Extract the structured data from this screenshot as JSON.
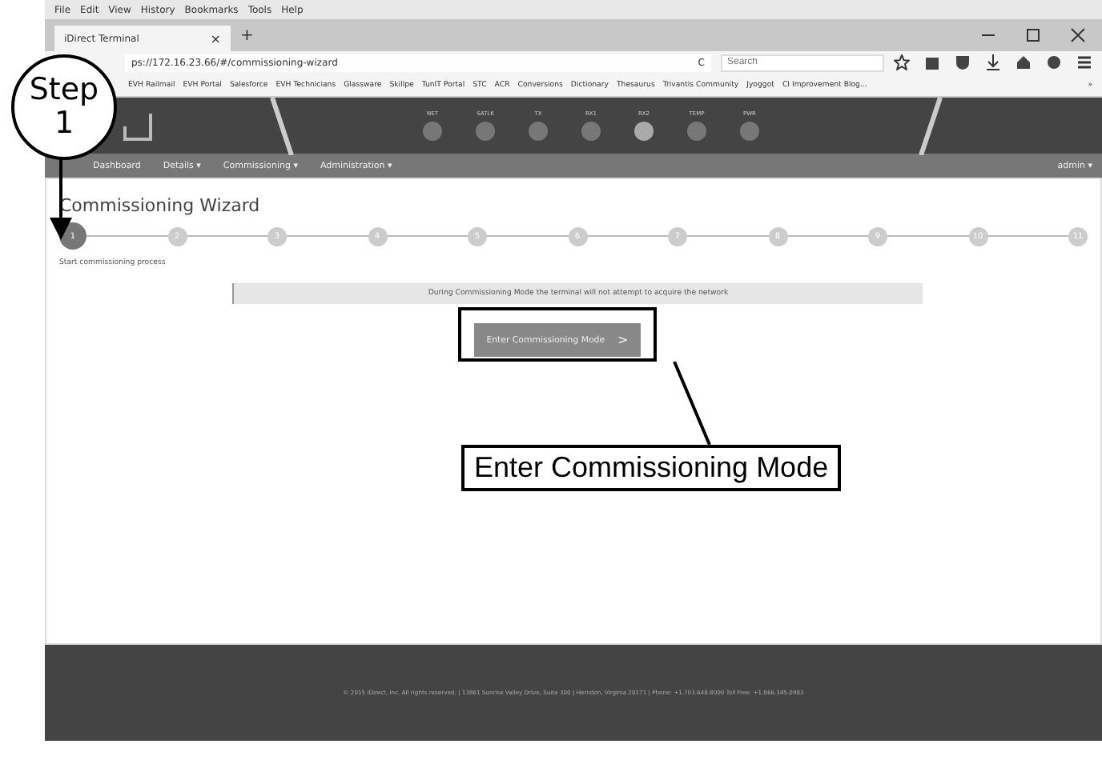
{
  "browser": {
    "menu": [
      "File",
      "Edit",
      "View",
      "History",
      "Bookmarks",
      "Tools",
      "Help"
    ],
    "tab": {
      "title": "iDirect Terminal",
      "close": "×"
    },
    "new_tab": "+",
    "url": "ps://172.16.23.66/#/commissioning-wizard",
    "reload": "C",
    "search": {
      "placeholder": "Search"
    },
    "bookmarks": [
      "EVH Railmail",
      "EVH Portal",
      "Salesforce",
      "EVH Technicians",
      "Glassware",
      "Skillpe",
      "TunIT Portal",
      "STC",
      "ACR",
      "Conversions",
      "Dictionary",
      "Thesaurus",
      "Trivantis Community",
      "Jyoggot",
      "CI Improvement Blog..."
    ],
    "bookmarks_more": "»"
  },
  "app": {
    "indicators": [
      {
        "label": "NET",
        "on": false
      },
      {
        "label": "SATLK",
        "on": false
      },
      {
        "label": "TX",
        "on": false
      },
      {
        "label": "RX1",
        "on": false
      },
      {
        "label": "RX2",
        "on": true
      },
      {
        "label": "TEMP",
        "on": false
      },
      {
        "label": "PWR",
        "on": false
      }
    ],
    "nav": [
      "Dashboard",
      "Details ▾",
      "Commissioning ▾",
      "Administration ▾"
    ],
    "user": "admin ▾",
    "page_title": "Commissioning Wizard",
    "steps": [
      {
        "label": "1",
        "selected": true
      },
      {
        "label": "2",
        "selected": false
      },
      {
        "label": "3",
        "selected": false
      },
      {
        "label": "4",
        "selected": false
      },
      {
        "label": "5",
        "selected": false
      },
      {
        "label": "6",
        "selected": false
      },
      {
        "label": "7",
        "selected": false
      },
      {
        "label": "8",
        "selected": false
      },
      {
        "label": "9",
        "selected": false
      },
      {
        "label": "10",
        "selected": false
      },
      {
        "label": "11",
        "selected": false
      }
    ],
    "step_caption": "Start commissioning process",
    "notice": "During Commissioning Mode the terminal will not attempt to acquire the network",
    "button": {
      "label": "Enter Commissioning Mode",
      "chevron": ">"
    },
    "footer": "© 2015 iDirect, Inc. All rights reserved. | 13861 Sunrise Valley Drive, Suite 300 | Herndon, Virginia 20171 | Phone: +1.703.648.8000 Toll Free: +1.866.345.0983"
  },
  "annotations": {
    "step_callout": {
      "word": "Step",
      "number": "1"
    },
    "button_callout": "Enter Commissioning Mode"
  }
}
